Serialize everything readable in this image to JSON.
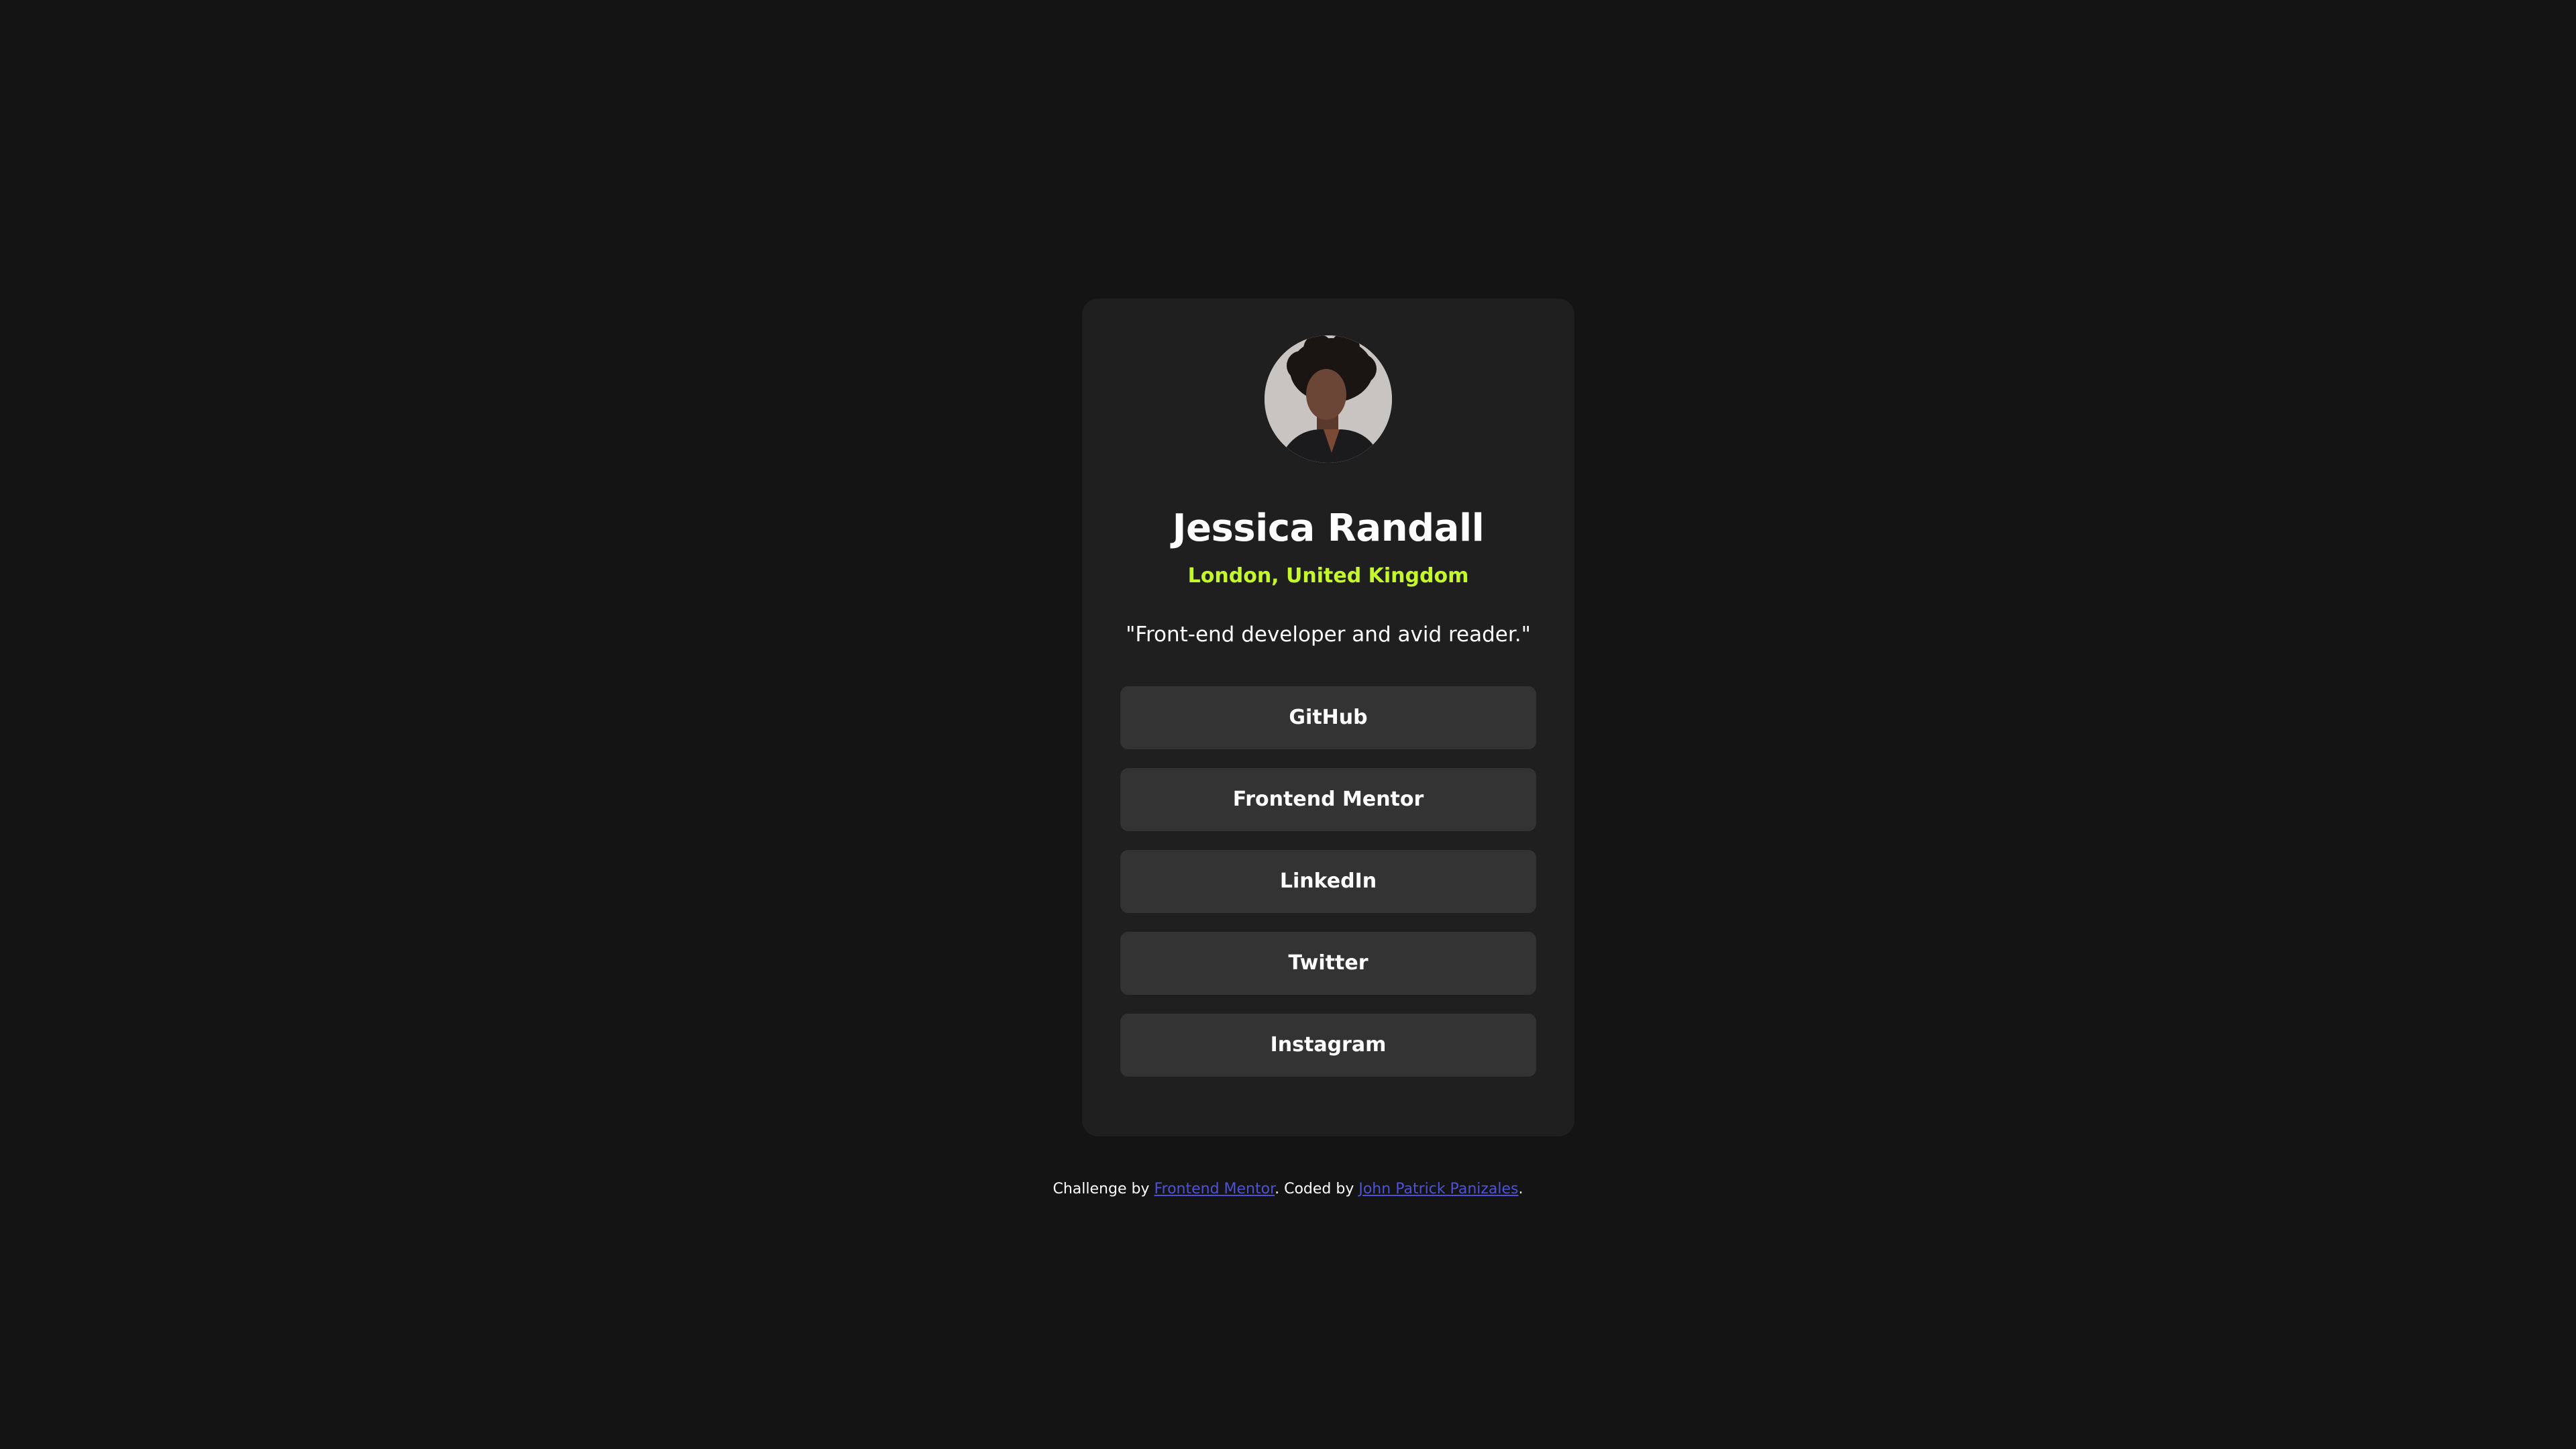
{
  "profile": {
    "avatar_icon": "profile-photo",
    "name": "Jessica Randall",
    "location": "London, United Kingdom",
    "bio": "\"Front-end developer and avid reader.\""
  },
  "links": [
    {
      "label": "GitHub"
    },
    {
      "label": "Frontend Mentor"
    },
    {
      "label": "LinkedIn"
    },
    {
      "label": "Twitter"
    },
    {
      "label": "Instagram"
    }
  ],
  "footer": {
    "prefix": "Challenge by ",
    "challenge_link": "Frontend Mentor",
    "middle": ". Coded by ",
    "author_link": "John Patrick Panizales",
    "suffix": "."
  },
  "colors": {
    "background": "#141414",
    "card": "#1f1f1f",
    "button": "#333333",
    "accent": "#c4f82a",
    "footer_link": "#4d52d6"
  }
}
